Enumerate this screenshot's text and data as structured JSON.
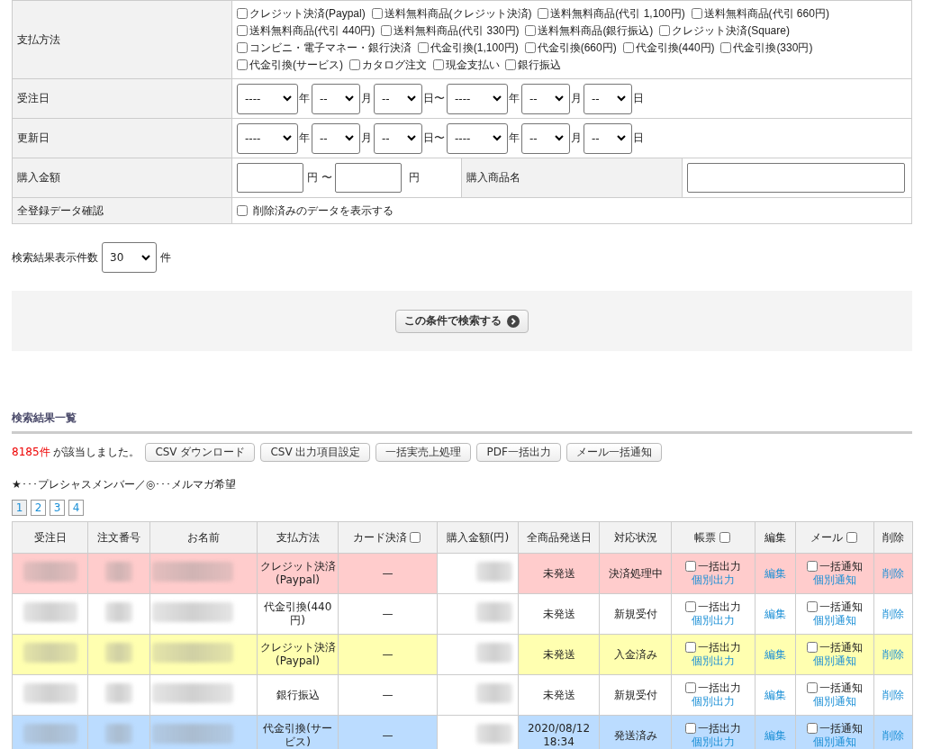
{
  "search_form": {
    "payment": {
      "label": "支払方法",
      "options": [
        {
          "label": "クレジット決済(Paypal)",
          "checked": false
        },
        {
          "label": "送料無料商品(クレジット決済)",
          "checked": false
        },
        {
          "label": "送料無料商品(代引 1,100円)",
          "checked": false
        },
        {
          "label": "送料無料商品(代引 660円)",
          "checked": false
        },
        {
          "label": "送料無料商品(代引 440円)",
          "checked": false
        },
        {
          "label": "送料無料商品(代引 330円)",
          "checked": false
        },
        {
          "label": "送料無料商品(銀行振込)",
          "checked": false
        },
        {
          "label": "クレジット決済(Square)",
          "checked": false
        },
        {
          "label": "コンビニ・電子マネー・銀行決済",
          "checked": false
        },
        {
          "label": "代金引換(1,100円)",
          "checked": false
        },
        {
          "label": "代金引換(660円)",
          "checked": false
        },
        {
          "label": "代金引換(440円)",
          "checked": false
        },
        {
          "label": "代金引換(330円)",
          "checked": false
        },
        {
          "label": "代金引換(サービス)",
          "checked": false
        },
        {
          "label": "カタログ注文",
          "checked": false
        },
        {
          "label": "現金支払い",
          "checked": false
        },
        {
          "label": "銀行振込",
          "checked": false
        }
      ]
    },
    "date_rows": [
      {
        "label": "受注日",
        "fields": [
          {
            "value": "----",
            "unit": "年"
          },
          {
            "value": "--",
            "unit": "月"
          },
          {
            "value": "--",
            "unit": "日〜"
          },
          {
            "value": "----",
            "unit": "年"
          },
          {
            "value": "--",
            "unit": "月"
          },
          {
            "value": "--",
            "unit": "日"
          }
        ]
      },
      {
        "label": "更新日",
        "fields": [
          {
            "value": "----",
            "unit": "年"
          },
          {
            "value": "--",
            "unit": "月"
          },
          {
            "value": "--",
            "unit": "日〜"
          },
          {
            "value": "----",
            "unit": "年"
          },
          {
            "value": "--",
            "unit": "月"
          },
          {
            "value": "--",
            "unit": "日"
          }
        ]
      }
    ],
    "amount": {
      "label": "購入金額",
      "from_unit": "円 〜",
      "to_unit": "円"
    },
    "product_name": {
      "label": "購入商品名"
    },
    "show_deleted": {
      "label": "全登録データ確認",
      "option": "削除済みのデータを表示する",
      "checked": false
    },
    "per_page": {
      "label": "検索結果表示件数",
      "value": "30",
      "unit": "件"
    },
    "search_button": "この条件で検索する"
  },
  "results": {
    "heading": "検索結果一覧",
    "count": "8185件",
    "count_text": "が該当しました。",
    "buttons": [
      "CSV ダウンロード",
      "CSV 出力項目設定",
      "一括実売上処理",
      "PDF一括出力",
      "メール一括通知"
    ],
    "legend": "★･･･プレシャスメンバー／◎･･･メルマガ希望",
    "pages": [
      {
        "label": "1",
        "selected": true
      },
      {
        "label": "2",
        "selected": false
      },
      {
        "label": "3",
        "selected": false
      },
      {
        "label": "4",
        "selected": false
      }
    ],
    "columns": [
      {
        "label": "受注日"
      },
      {
        "label": "注文番号"
      },
      {
        "label": "お名前"
      },
      {
        "label": "支払方法"
      },
      {
        "label": "カード決済",
        "checked": false
      },
      {
        "label": "購入金額(円)"
      },
      {
        "label": "全商品発送日"
      },
      {
        "label": "対応状況"
      },
      {
        "label": "帳票",
        "checked": false
      },
      {
        "label": "編集"
      },
      {
        "label": "メール",
        "checked": false
      },
      {
        "label": "削除"
      }
    ],
    "rows": [
      {
        "color": "#ffcccc",
        "payment": "クレジット決済(Paypal)",
        "card": "—",
        "ship_date": "未発送",
        "status": "決済処理中",
        "slip_check": "一括出力",
        "slip_checked": false,
        "slip_link": "個別出力",
        "edit": "編集",
        "mail_check": "一括通知",
        "mail_checked": false,
        "mail_link": "個別通知",
        "delete": "削除"
      },
      {
        "color": "#ffffff",
        "payment": "代金引換(440円)",
        "card": "—",
        "ship_date": "未発送",
        "status": "新規受付",
        "slip_check": "一括出力",
        "slip_checked": false,
        "slip_link": "個別出力",
        "edit": "編集",
        "mail_check": "一括通知",
        "mail_checked": false,
        "mail_link": "個別通知",
        "delete": "削除"
      },
      {
        "color": "#ffffb0",
        "payment": "クレジット決済(Paypal)",
        "card": "—",
        "ship_date": "未発送",
        "status": "入金済み",
        "slip_check": "一括出力",
        "slip_checked": false,
        "slip_link": "個別出力",
        "edit": "編集",
        "mail_check": "一括通知",
        "mail_checked": false,
        "mail_link": "個別通知",
        "delete": "削除"
      },
      {
        "color": "#ffffff",
        "payment": "銀行振込",
        "card": "—",
        "ship_date": "未発送",
        "status": "新規受付",
        "slip_check": "一括出力",
        "slip_checked": false,
        "slip_link": "個別出力",
        "edit": "編集",
        "mail_check": "一括通知",
        "mail_checked": false,
        "mail_link": "個別通知",
        "delete": "削除"
      },
      {
        "color": "#bbdcff",
        "payment": "代金引換(サービス)",
        "card": "—",
        "ship_date": "2020/08/12 18:34",
        "status": "発送済み",
        "slip_check": "一括出力",
        "slip_checked": false,
        "slip_link": "個別出力",
        "edit": "編集",
        "mail_check": "一括通知",
        "mail_checked": false,
        "mail_link": "個別通知",
        "delete": "削除"
      }
    ]
  }
}
